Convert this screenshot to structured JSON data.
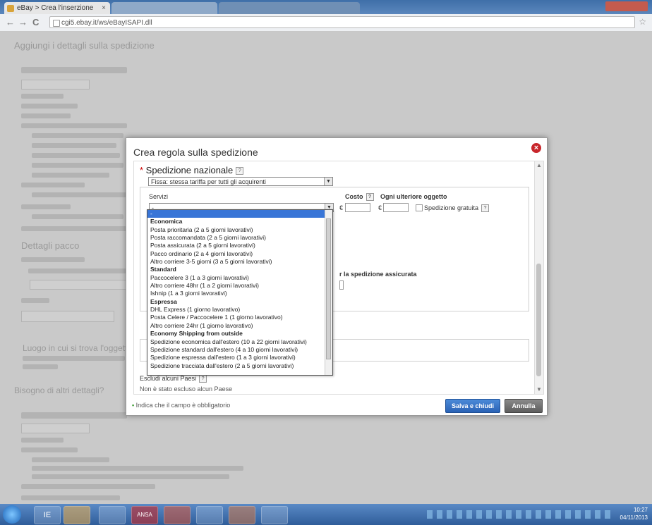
{
  "browser": {
    "tab_title": "eBay > Crea l'inserzione",
    "tab_close": "×",
    "url": "cgi5.ebay.it/ws/eBayISAPI.dll",
    "back": "←",
    "forward": "→",
    "reload": "C",
    "star": "☆"
  },
  "background_page": {
    "heading1": "Aggiungi i dettagli sulla spedizione",
    "heading2": "Dettagli pacco",
    "heading3": "Luogo in cui si trova l'oggetto",
    "heading4": "Bisogno di altri dettagli?"
  },
  "dialog": {
    "title": "Crea regola sulla spedizione",
    "close": "×",
    "section_title": "Spedizione nazionale",
    "help": "?",
    "rate_type_value": "Fissa: stessa tariffa per tutti gli acquirenti",
    "col_services": "Servizi",
    "col_cost": "Costo",
    "col_each_additional": "Ogni ulteriore oggetto",
    "currency": "€",
    "free_shipping": "Spedizione gratuita",
    "service_selected": "-",
    "partial_label": "r la spedizione assicurata",
    "exclude_countries": "Escludi alcuni Paesi",
    "no_excluded": "Non è stato escluso alcun Paese",
    "required_note": "Indica che il campo è obbligatorio",
    "save_button": "Salva e chiudi",
    "cancel_button": "Annulla"
  },
  "dropdown": {
    "items": [
      {
        "label": "-",
        "type": "selected"
      },
      {
        "label": "Economica",
        "type": "group"
      },
      {
        "label": "Posta prioritaria (2 a 5 giorni lavorativi)",
        "type": "option"
      },
      {
        "label": "Posta raccomandata (2 a 5 giorni lavorativi)",
        "type": "option"
      },
      {
        "label": "Posta assicurata (2 a 5 giorni lavorativi)",
        "type": "option"
      },
      {
        "label": "Pacco ordinario (2 a 4 giorni lavorativi)",
        "type": "option"
      },
      {
        "label": "Altro corriere 3-5 giorni (3 a 5 giorni lavorativi)",
        "type": "option"
      },
      {
        "label": "Standard",
        "type": "group"
      },
      {
        "label": "Paccocelere 3 (1 a 3 giorni lavorativi)",
        "type": "option"
      },
      {
        "label": "Altro corriere 48hr (1 a 2 giorni lavorativi)",
        "type": "option"
      },
      {
        "label": "Ishnip (1 a 3 giorni lavorativi)",
        "type": "option"
      },
      {
        "label": "Espressa",
        "type": "group"
      },
      {
        "label": "DHL Express (1 giorno lavorativo)",
        "type": "option"
      },
      {
        "label": "Posta Celere / Paccocelere 1 (1 giorno lavorativo)",
        "type": "option"
      },
      {
        "label": "Altro corriere 24hr (1 giorno lavorativo)",
        "type": "option"
      },
      {
        "label": "Economy Shipping from outside",
        "type": "group"
      },
      {
        "label": "Spedizione economica dall'estero (10 a 22 giorni lavorativi)",
        "type": "option"
      },
      {
        "label": "Spedizione standard dall'estero (4 a 10 giorni lavorativi)",
        "type": "option"
      },
      {
        "label": "Spedizione espressa dall'estero (1 a 3 giorni lavorativi)",
        "type": "option"
      },
      {
        "label": "Spedizione tracciata dall'estero (2 a 5 giorni lavorativi)",
        "type": "option"
      }
    ]
  },
  "taskbar": {
    "time": "10:27",
    "date": "04/11/2013",
    "items": [
      "IE",
      "",
      "",
      "ANSA",
      "",
      "",
      "",
      ""
    ]
  },
  "colors": {
    "accent": "#2a62b5",
    "close_red": "#c8262b",
    "highlight": "#3875d7"
  }
}
